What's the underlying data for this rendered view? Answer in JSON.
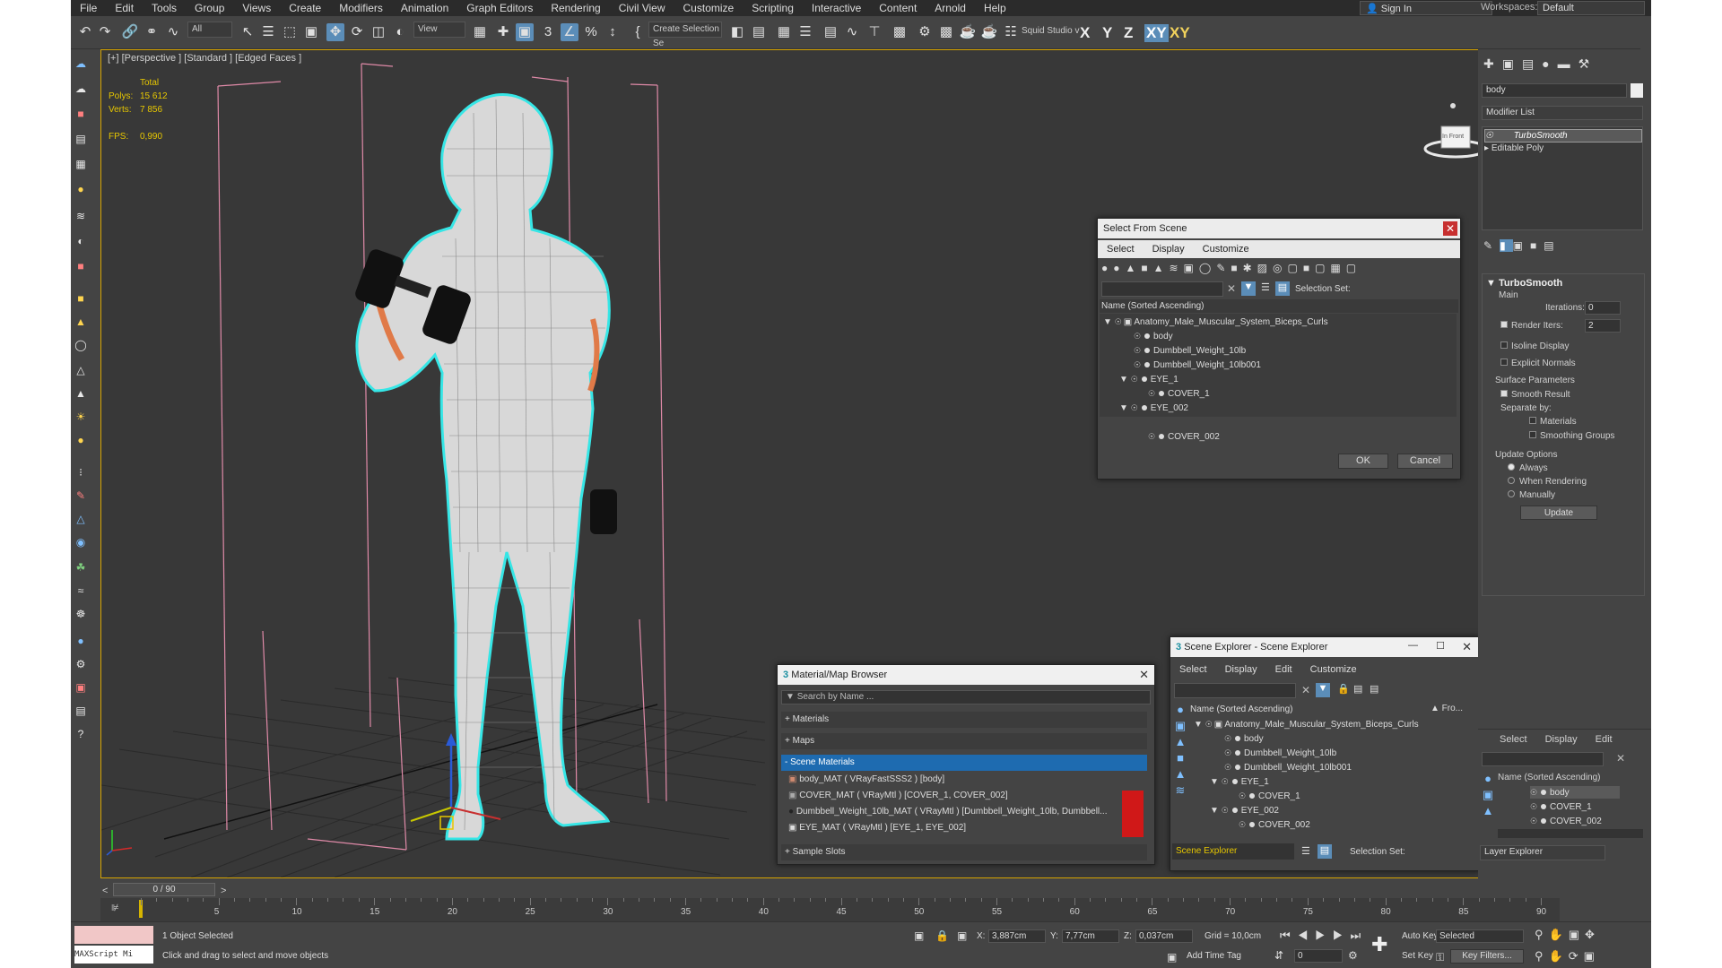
{
  "menu": [
    "File",
    "Edit",
    "Tools",
    "Group",
    "Views",
    "Create",
    "Modifiers",
    "Animation",
    "Graph Editors",
    "Rendering",
    "Civil View",
    "Customize",
    "Scripting",
    "Interactive",
    "Content",
    "Arnold",
    "Help"
  ],
  "signin": "Sign In",
  "workspace": {
    "label": "Workspaces:",
    "value": "Default"
  },
  "toolbar": {
    "filter": "All",
    "refcoord": "View",
    "selection_set": "Create Selection Se",
    "studio": "Squid Studio v",
    "axes": [
      "X",
      "Y",
      "Z",
      "XY",
      "XY"
    ]
  },
  "viewport": {
    "label": "[+] [Perspective ] [Standard ] [Edged Faces ]",
    "stats": {
      "total_label": "Total",
      "polys_label": "Polys:",
      "polys": "15 612",
      "verts_label": "Verts:",
      "verts": "7 856",
      "fps_label": "FPS:",
      "fps": "0,990"
    },
    "viewcube_label": "In  Front"
  },
  "command_panel": {
    "object_name": "body",
    "modifier_list": "Modifier List",
    "stack": [
      "TurboSmooth",
      "Editable Poly"
    ],
    "rollout_title": "TurboSmooth",
    "main_label": "Main",
    "iterations_label": "Iterations:",
    "iterations": "0",
    "render_iters_label": "Render Iters:",
    "render_iters": "2",
    "isoline": "Isoline Display",
    "explicit": "Explicit Normals",
    "surface_params": "Surface Parameters",
    "smooth_result": "Smooth Result",
    "separate_by": "Separate by:",
    "materials": "Materials",
    "smoothing_groups": "Smoothing Groups",
    "update_options": "Update Options",
    "always": "Always",
    "when_rendering": "When Rendering",
    "manually": "Manually",
    "update_btn": "Update"
  },
  "layer_explorer": {
    "tabs": [
      "Select",
      "Display",
      "Edit"
    ],
    "header": "Name (Sorted Ascending)",
    "items": [
      "body",
      "COVER_1",
      "COVER_002"
    ],
    "footer": "Layer Explorer"
  },
  "select_dialog": {
    "title": "Select From Scene",
    "tabs": [
      "Select",
      "Display",
      "Customize"
    ],
    "selection_set_label": "Selection Set:",
    "header": "Name (Sorted Ascending)",
    "tree": [
      {
        "name": "Anatomy_Male_Muscular_System_Biceps_Curls",
        "level": 0
      },
      {
        "name": "body",
        "level": 1
      },
      {
        "name": "Dumbbell_Weight_10lb",
        "level": 1
      },
      {
        "name": "Dumbbell_Weight_10lb001",
        "level": 1
      },
      {
        "name": "EYE_1",
        "level": 1
      },
      {
        "name": "COVER_1",
        "level": 2
      },
      {
        "name": "EYE_002",
        "level": 1
      },
      {
        "name": "COVER_002",
        "level": 2
      }
    ],
    "ok": "OK",
    "cancel": "Cancel"
  },
  "material_browser": {
    "title": "Material/Map Browser",
    "search_placeholder": "Search by Name ...",
    "sections": [
      "+ Materials",
      "+ Maps",
      "- Scene Materials",
      "+ Sample Slots"
    ],
    "materials": [
      "body_MAT  ( VRayFastSSS2 )  [body]",
      "COVER_MAT  ( VRayMtl )  [COVER_1, COVER_002]",
      "Dumbbell_Weight_10lb_MAT  ( VRayMtl )  [Dumbbell_Weight_10lb, Dumbbell...",
      "EYE_MAT  ( VRayMtl )  [EYE_1, EYE_002]"
    ]
  },
  "scene_explorer": {
    "title": "Scene Explorer - Scene Explorer",
    "tabs": [
      "Select",
      "Display",
      "Edit",
      "Customize"
    ],
    "header": "Name (Sorted Ascending)",
    "header_right": "▲ Fro...",
    "tree": [
      {
        "name": "Anatomy_Male_Muscular_System_Biceps_Curls",
        "level": 0
      },
      {
        "name": "body",
        "level": 1
      },
      {
        "name": "Dumbbell_Weight_10lb",
        "level": 1
      },
      {
        "name": "Dumbbell_Weight_10lb001",
        "level": 1
      },
      {
        "name": "EYE_1",
        "level": 1
      },
      {
        "name": "COVER_1",
        "level": 2
      },
      {
        "name": "EYE_002",
        "level": 1
      },
      {
        "name": "COVER_002",
        "level": 2
      }
    ],
    "footer_name": "Scene Explorer",
    "selection_set_label": "Selection Set:"
  },
  "timeline": {
    "frame_display": "0 / 90",
    "ticks": [
      "5",
      "10",
      "15",
      "20",
      "25",
      "30",
      "35",
      "40",
      "45",
      "50",
      "55",
      "60",
      "65",
      "70",
      "75",
      "80",
      "85",
      "90"
    ]
  },
  "status": {
    "maxscript": "MAXScript Mi",
    "selected": "1 Object Selected",
    "hint": "Click and drag to select and move objects",
    "x_label": "X:",
    "x": "3,887cm",
    "y_label": "Y:",
    "y": "7,77cm",
    "z_label": "Z:",
    "z": "0,037cm",
    "grid": "Grid = 10,0cm",
    "add_time_tag": "Add Time Tag",
    "frame": "0",
    "auto_key": "Auto Key",
    "selected_dropdown": "Selected",
    "set_key": "Set Key",
    "key_filters": "Key Filters..."
  }
}
